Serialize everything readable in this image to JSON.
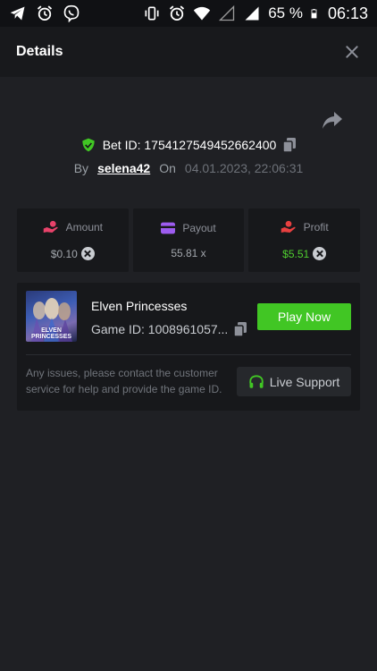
{
  "status_bar": {
    "left_icons": [
      "telegram-icon",
      "alarm-clock-icon",
      "viber-icon"
    ],
    "right_icons": [
      "vibrate-icon",
      "alarm-clock-icon",
      "wifi-icon",
      "signal-empty-icon",
      "signal-full-icon",
      "battery-icon"
    ],
    "battery": "65 %",
    "time": "06:13"
  },
  "header": {
    "title": "Details",
    "close_icon": "close-icon"
  },
  "bet": {
    "share_icon": "share-icon",
    "shield_icon": "shield-check-icon",
    "bet_id_label": "Bet ID: 1754127549452662400",
    "copy_icon": "copy-icon",
    "by_label": "By",
    "username": "selena42",
    "on_label": "On",
    "datetime": "04.01.2023, 22:06:31"
  },
  "stats": [
    {
      "label": "Amount",
      "value": "$0.10",
      "icon": "hand-coins-icon",
      "icon_color": "#e8426a"
    },
    {
      "label": "Payout",
      "value": "55.81 x",
      "icon": "card-icon",
      "icon_color": "#9d5cf0"
    },
    {
      "label": "Profit",
      "value": "$5.51",
      "icon": "profit-hand-icon",
      "icon_color": "#e84040"
    }
  ],
  "game": {
    "thumbnail_text": "ELVEN PRINCESSES",
    "title": "Elven Princesses",
    "game_id": "Game ID: 1008961057...",
    "play_label": "Play Now",
    "issue_text": "Any issues, please contact the customer service for help and provide the game ID.",
    "support_label": "Live Support",
    "headset_icon": "headset-icon"
  },
  "colors": {
    "accent_green": "#41c624",
    "background": "#1f2024",
    "card": "#17181b",
    "header": "#18191c"
  }
}
